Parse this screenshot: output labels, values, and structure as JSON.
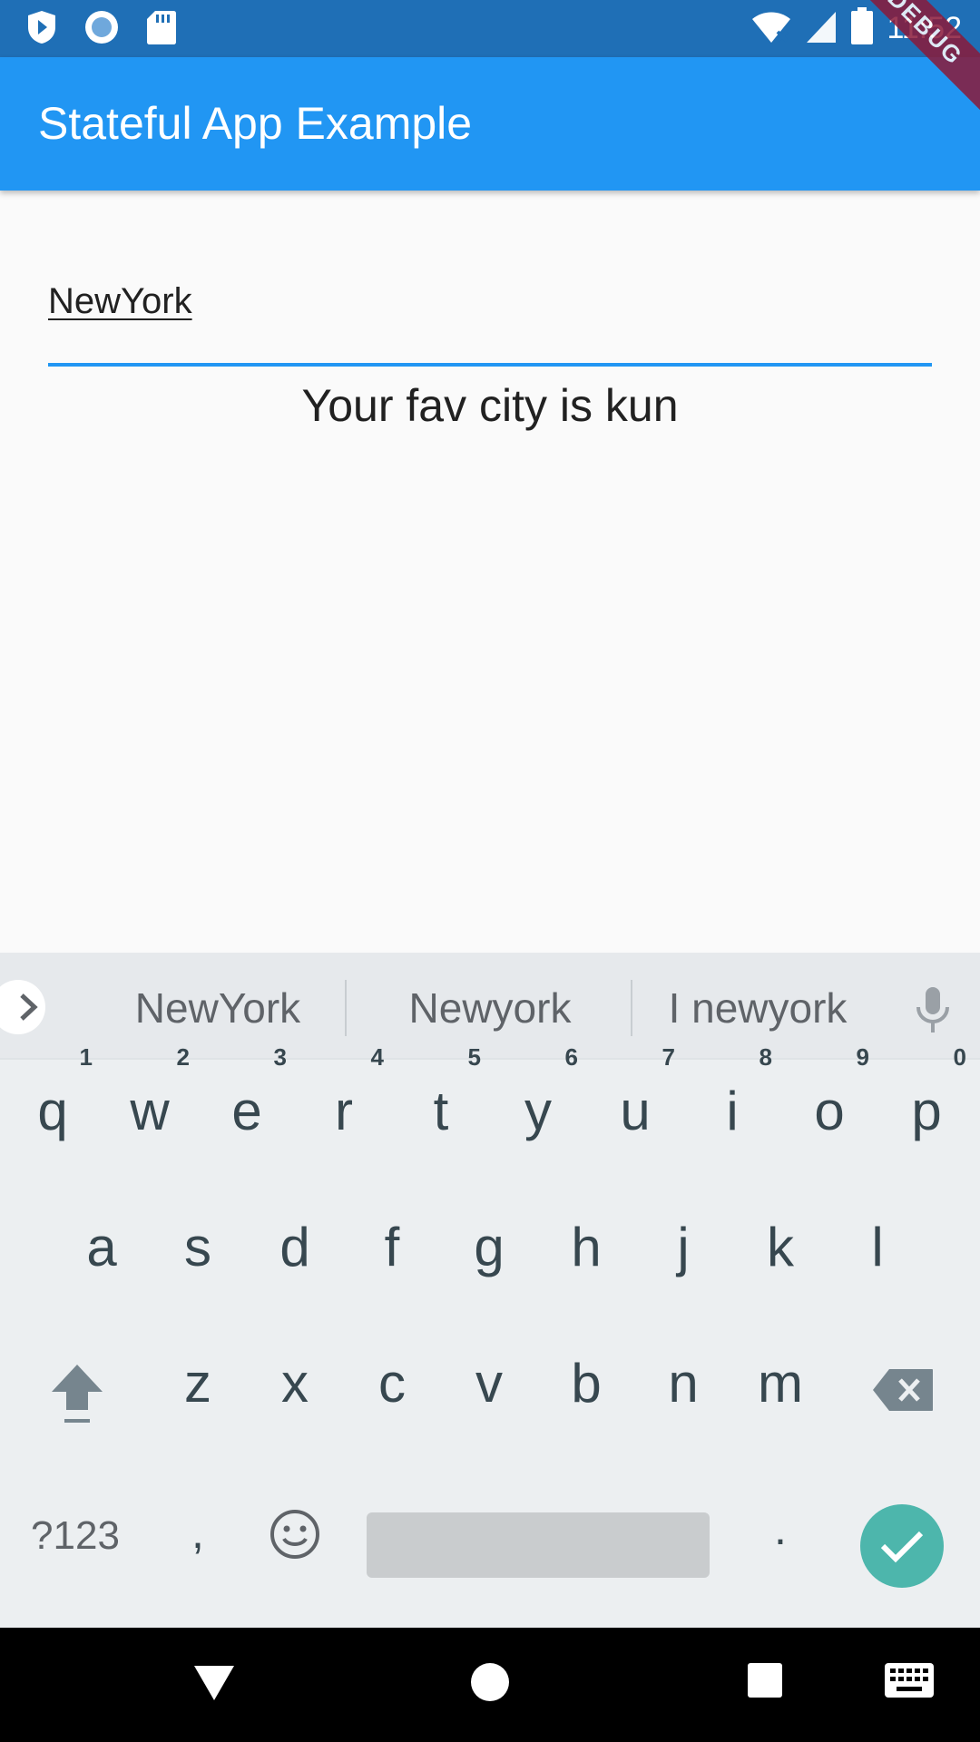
{
  "status_bar": {
    "time": "11:52",
    "icons": [
      "shield-play-icon",
      "circle-record-icon",
      "sd-card-icon",
      "wifi-off-icon",
      "signal-icon",
      "battery-icon"
    ]
  },
  "debug_banner": "DEBUG",
  "app_bar": {
    "title": "Stateful App Example"
  },
  "text_field": {
    "value": "NewYork"
  },
  "result_text": "Your fav city is kun",
  "keyboard": {
    "suggestions": [
      "NewYork",
      "Newyork",
      "I newyork"
    ],
    "row1": [
      {
        "key": "q",
        "hint": "1"
      },
      {
        "key": "w",
        "hint": "2"
      },
      {
        "key": "e",
        "hint": "3"
      },
      {
        "key": "r",
        "hint": "4"
      },
      {
        "key": "t",
        "hint": "5"
      },
      {
        "key": "y",
        "hint": "6"
      },
      {
        "key": "u",
        "hint": "7"
      },
      {
        "key": "i",
        "hint": "8"
      },
      {
        "key": "o",
        "hint": "9"
      },
      {
        "key": "p",
        "hint": "0"
      }
    ],
    "row2": [
      "a",
      "s",
      "d",
      "f",
      "g",
      "h",
      "j",
      "k",
      "l"
    ],
    "row3": [
      "z",
      "x",
      "c",
      "v",
      "b",
      "n",
      "m"
    ],
    "row4": {
      "symbols": "?123",
      "comma": ",",
      "period": "."
    },
    "accent_color": "#4db6ac"
  },
  "colors": {
    "app_bar": "#2196f3",
    "status_bar": "#1f6fb6",
    "field_underline": "#2196f3"
  },
  "nav_icons": [
    "back-triangle-icon",
    "home-circle-icon",
    "recents-square-icon",
    "keyboard-icon"
  ]
}
